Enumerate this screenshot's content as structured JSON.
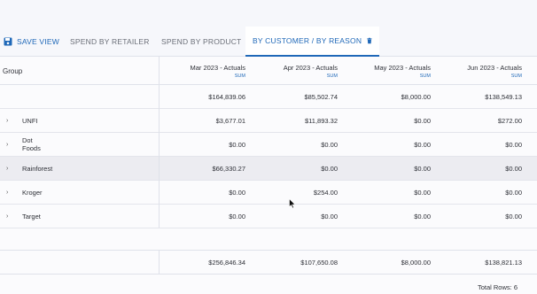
{
  "toolbar": {
    "save_view_label": "SAVE VIEW",
    "tabs": [
      {
        "label": "SPEND BY RETAILER"
      },
      {
        "label": "SPEND BY PRODUCT"
      },
      {
        "label": "BY CUSTOMER / BY REASON"
      }
    ]
  },
  "grid": {
    "group_header": "Group",
    "columns": [
      {
        "label": "Mar 2023 - Actuals",
        "agg": "SUM"
      },
      {
        "label": "Apr 2023 - Actuals",
        "agg": "SUM"
      },
      {
        "label": "May 2023 - Actuals",
        "agg": "SUM"
      },
      {
        "label": "Jun 2023 - Actuals",
        "agg": "SUM"
      }
    ],
    "top_totals": [
      "$164,839.06",
      "$85,502.74",
      "$8,000.00",
      "$138,549.13"
    ],
    "rows": [
      {
        "name": "UNFI",
        "values": [
          "$3,677.01",
          "$11,893.32",
          "$0.00",
          "$272.00"
        ]
      },
      {
        "name": "Dot Foods",
        "values": [
          "$0.00",
          "$0.00",
          "$0.00",
          "$0.00"
        ]
      },
      {
        "name": "Rainforest",
        "values": [
          "$66,330.27",
          "$0.00",
          "$0.00",
          "$0.00"
        ]
      },
      {
        "name": "Kroger",
        "values": [
          "$0.00",
          "$254.00",
          "$0.00",
          "$0.00"
        ]
      },
      {
        "name": "Target",
        "values": [
          "$0.00",
          "$0.00",
          "$0.00",
          "$0.00"
        ]
      }
    ],
    "footer_totals": [
      "$256,846.34",
      "$107,650.08",
      "$8,000.00",
      "$138,821.13"
    ],
    "total_rows_label": "Total Rows: 6"
  },
  "colors": {
    "accent": "#1f68b8",
    "highlight_row": "#ececf1"
  }
}
